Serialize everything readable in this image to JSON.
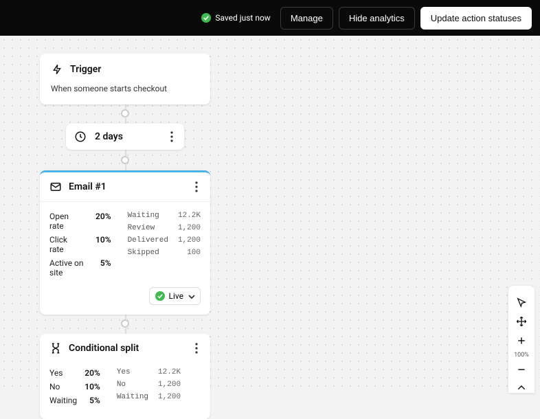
{
  "header": {
    "save_status": "Saved just now",
    "manage": "Manage",
    "hide_analytics": "Hide analytics",
    "update_statuses": "Update action statuses"
  },
  "trigger": {
    "title": "Trigger",
    "subtitle": "When someone starts checkout"
  },
  "delay": {
    "label": "2 days"
  },
  "email": {
    "title": "Email #1",
    "rates": [
      {
        "label": "Open rate",
        "value": "20%"
      },
      {
        "label": "Click rate",
        "value": "10%"
      },
      {
        "label": "Active on site",
        "value": "5%"
      }
    ],
    "counts": [
      {
        "label": "Waiting",
        "value": "12.2K"
      },
      {
        "label": "Review",
        "value": "1,200"
      },
      {
        "label": "Delivered",
        "value": "1,200"
      },
      {
        "label": "Skipped",
        "value": "100"
      }
    ],
    "status": "Live"
  },
  "split": {
    "title": "Conditional split",
    "rates": [
      {
        "label": "Yes",
        "value": "20%"
      },
      {
        "label": "No",
        "value": "10%"
      },
      {
        "label": "Waiting",
        "value": "5%"
      }
    ],
    "counts": [
      {
        "label": "Yes",
        "value": "12.2K"
      },
      {
        "label": "No",
        "value": "1,200"
      },
      {
        "label": "Waiting",
        "value": "1,200"
      }
    ]
  },
  "tools": {
    "zoom": "100%"
  }
}
